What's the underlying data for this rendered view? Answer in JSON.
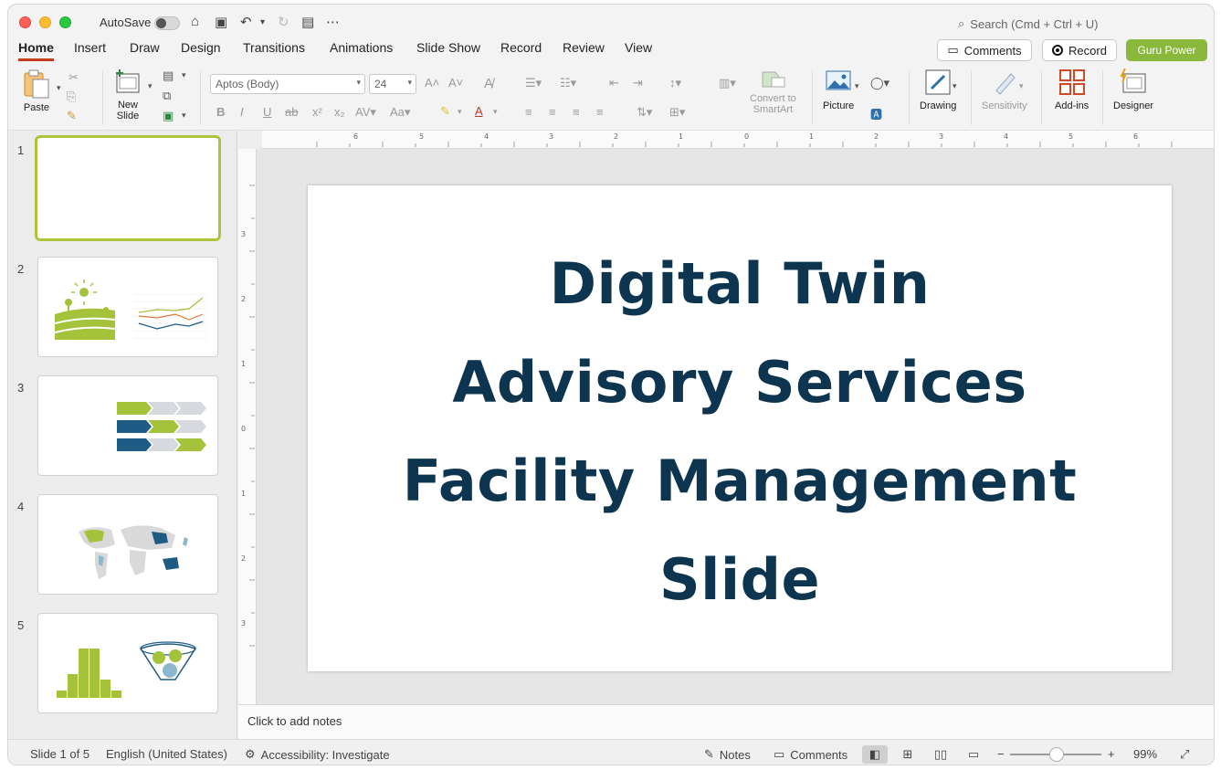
{
  "titlebar": {
    "autosave_label": "AutoSave",
    "search_placeholder": "Search (Cmd + Ctrl + U)"
  },
  "tabs": [
    "Home",
    "Insert",
    "Draw",
    "Design",
    "Transitions",
    "Animations",
    "Slide Show",
    "Record",
    "Review",
    "View"
  ],
  "header_buttons": {
    "comments": "Comments",
    "record": "Record",
    "guru": "Guru Power"
  },
  "ribbon": {
    "paste": "Paste",
    "new_slide": "New\nSlide",
    "font_name": "Aptos (Body)",
    "font_size": "24",
    "convert_smartart": "Convert to\nSmartArt",
    "picture": "Picture",
    "drawing": "Drawing",
    "sensitivity": "Sensitivity",
    "addins": "Add-ins",
    "designer": "Designer"
  },
  "thumbnails": [
    "1",
    "2",
    "3",
    "4",
    "5"
  ],
  "slide": {
    "title_lines": [
      "Digital Twin",
      "Advisory Services",
      "Facility Management",
      "Slide"
    ]
  },
  "notes_placeholder": "Click to add notes",
  "status": {
    "slide_count": "Slide 1 of 5",
    "language": "English (United States)",
    "accessibility": "Accessibility: Investigate",
    "notes": "Notes",
    "comments": "Comments",
    "zoom": "99%"
  },
  "colors": {
    "accent": "#c43e1c",
    "guru": "#8ab83a",
    "title": "#0d3550",
    "thumb_green": "#a4c23a",
    "thumb_blue": "#1f5b84"
  }
}
